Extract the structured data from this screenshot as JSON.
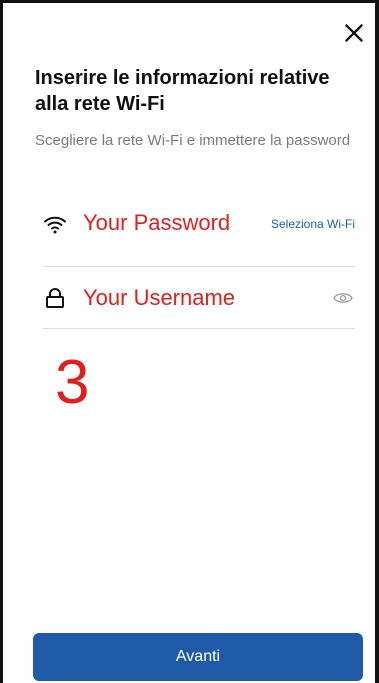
{
  "dialog": {
    "title": "Inserire le informazioni relative alla rete Wi-Fi",
    "subtitle": "Scegliere la rete Wi-Fi e immettere la password"
  },
  "wifi_row": {
    "icon": "wifi-icon",
    "value": "Your Password",
    "action_label": "Seleziona Wi-Fi"
  },
  "password_row": {
    "icon": "lock-icon",
    "value": "Your Username",
    "toggle_icon": "eye-icon"
  },
  "annotation": {
    "step_number": "3"
  },
  "footer": {
    "next_label": "Avanti"
  },
  "colors": {
    "accent_blue": "#1e5aa8",
    "link_blue": "#1a5fb4",
    "annotation_red": "#e02020"
  }
}
